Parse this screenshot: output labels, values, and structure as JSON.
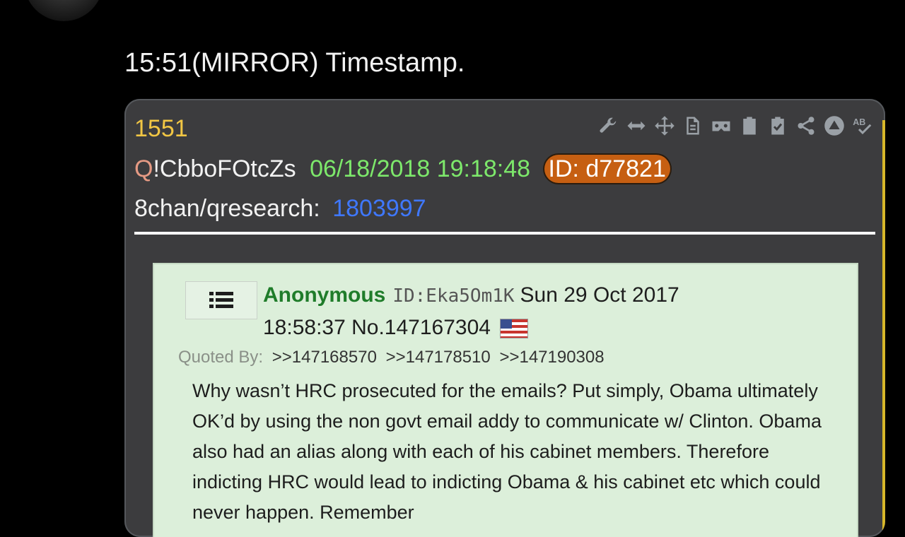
{
  "tweet": {
    "text": "15:51(MIRROR) Timestamp."
  },
  "card": {
    "post_number": "1551",
    "toolbar_icons": [
      "wrench-icon",
      "arrows-horizontal-icon",
      "move-icon",
      "document-icon",
      "vr-icon",
      "clipboard-icon",
      "clipboard-check-icon",
      "share-icon",
      "warning-icon",
      "spellcheck-icon"
    ],
    "tripcode_q": "Q",
    "tripcode_rest": "!CbboFOtcZs",
    "timestamp": "06/18/2018 19:18:48",
    "id_badge": "ID: d77821",
    "board": "8chan/qresearch:",
    "thread": "1803997",
    "quote": {
      "name": "Anonymous",
      "poster_id": "ID:Eka5Om1K",
      "date_part1": "Sun 29 Oct 2017",
      "date_part2": "18:58:37 No.147167304",
      "quoted_by_label": "Quoted By:",
      "quoted_by_refs": [
        ">>147168570",
        ">>147178510",
        ">>147190308"
      ],
      "body": "Why wasn’t HRC prosecuted for the emails? Put simply, Obama ultimately OK’d by using the non govt email addy to communicate w/ Clinton. Obama also had an alias along with each of his cabinet members. Therefore indicting HRC would lead to indicting Obama & his cabinet etc which could never happen. Remember"
    }
  },
  "colors": {
    "post_number": "#f1c644",
    "timestamp": "#7de86b",
    "id_badge": "#c65f12",
    "thread_link": "#3f78ff",
    "anon_name": "#1f7c2a",
    "quote_bg": "#dcefda"
  }
}
